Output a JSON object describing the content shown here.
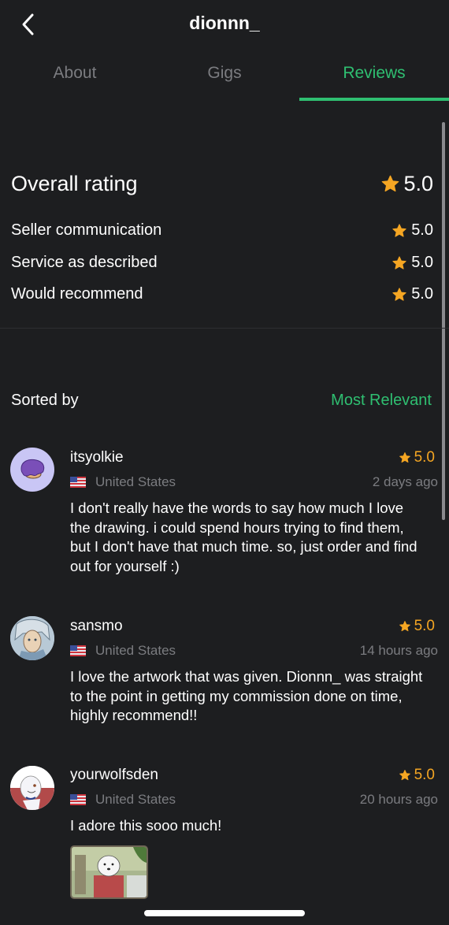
{
  "header": {
    "title": "dionnn_",
    "back_icon": "chevron-left-icon"
  },
  "tabs": [
    {
      "label": "About",
      "active": false
    },
    {
      "label": "Gigs",
      "active": false
    },
    {
      "label": "Reviews",
      "active": true
    }
  ],
  "colors": {
    "background": "#1d1e20",
    "accent": "#2fbf71",
    "star": "#f5a623",
    "muted": "#7b7c80",
    "text": "#ffffff"
  },
  "ratings": {
    "overall": {
      "label": "Overall rating",
      "value": "5.0"
    },
    "breakdown": [
      {
        "label": "Seller communication",
        "value": "5.0"
      },
      {
        "label": "Service as described",
        "value": "5.0"
      },
      {
        "label": "Would recommend",
        "value": "5.0"
      }
    ]
  },
  "sort": {
    "label": "Sorted by",
    "value": "Most Relevant"
  },
  "reviews": [
    {
      "username": "itsyolkie",
      "rating": "5.0",
      "country": "United States",
      "flag_icon": "us-flag-icon",
      "time": "2 days ago",
      "text": "I don't really have the words to say how much I love the drawing. i could spend hours trying to find them, but I don't have that much time. so, just order and find out for yourself :)"
    },
    {
      "username": "sansmo",
      "rating": "5.0",
      "country": "United States",
      "flag_icon": "us-flag-icon",
      "time": "14 hours ago",
      "text": "I love the artwork that was given. Dionnn_ was straight to the point in getting my commission done on time, highly recommend!!"
    },
    {
      "username": "yourwolfsden",
      "rating": "5.0",
      "country": "United States",
      "flag_icon": "us-flag-icon",
      "time": "20 hours ago",
      "text": "I adore this sooo much!",
      "has_attachment": true
    }
  ]
}
